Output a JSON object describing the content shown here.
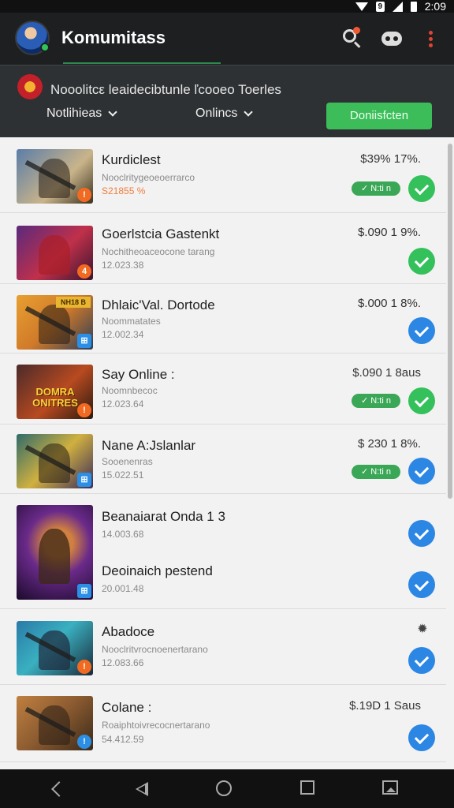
{
  "status_bar": {
    "time": "2:09",
    "sim_label": "9"
  },
  "app_bar": {
    "title": "Komumitass"
  },
  "sub_header": {
    "notice": "Nooolitcε leaidecibtunle ľcooeo  Toerles",
    "filter1": "Notlihieas",
    "filter2": "Onlincs",
    "cta_label": "Doniisfcten"
  },
  "items": [
    {
      "name": "Kurdiclest",
      "sub": "Nooclritygeoeoerrarco",
      "num": "S21855 %",
      "price": "$39% 17%.",
      "pill": "✓ N:ti n",
      "check": "green",
      "tag": "!"
    },
    {
      "name": "Goerlstcia Gastenkt",
      "sub": "Nochitheoaceocone tarang",
      "num": "12.023.38",
      "price": "$.090 1 9%.",
      "check": "green",
      "tag": "4"
    },
    {
      "name": "Dhlaic'Val. Dortode",
      "sub": "Noommatates",
      "num": "12.002.34",
      "price": "$.000 1 8%.",
      "check": "blue",
      "tag": "⊞",
      "overlay": "NH18 B"
    },
    {
      "name": "Say Online :",
      "sub": "Noomnbecoc",
      "num": "12.023.64",
      "price": "$.090 1 8aus",
      "pill": "✓ N:ti n",
      "check": "green",
      "tag": "!",
      "overlay": "DOMRA ONITRES"
    },
    {
      "name": "Nane A:Jslanlar",
      "sub": "Sooenenras",
      "num": "15.022.51",
      "price": "$ 230 1 8%.",
      "pill": "✓ N:ti n",
      "check": "blue",
      "tag": "⊞"
    },
    {
      "name": "Beanaiarat Onda 1 3",
      "num": "14.003.68",
      "name2": "Deoinaich pestend",
      "num2": "20.001.48",
      "check": "blue",
      "tag": "⊞"
    },
    {
      "name": "Abadoce",
      "sub": "Nooclritvrocnoenertarano",
      "num": "12.083.66",
      "check": "blue",
      "tag": "!"
    },
    {
      "name": "Colane :",
      "sub": "Roaiphtoivrecocnertarano",
      "num": "54.412.59",
      "price": "$.19D 1 Saus",
      "check": "blue",
      "tag": "!"
    }
  ]
}
